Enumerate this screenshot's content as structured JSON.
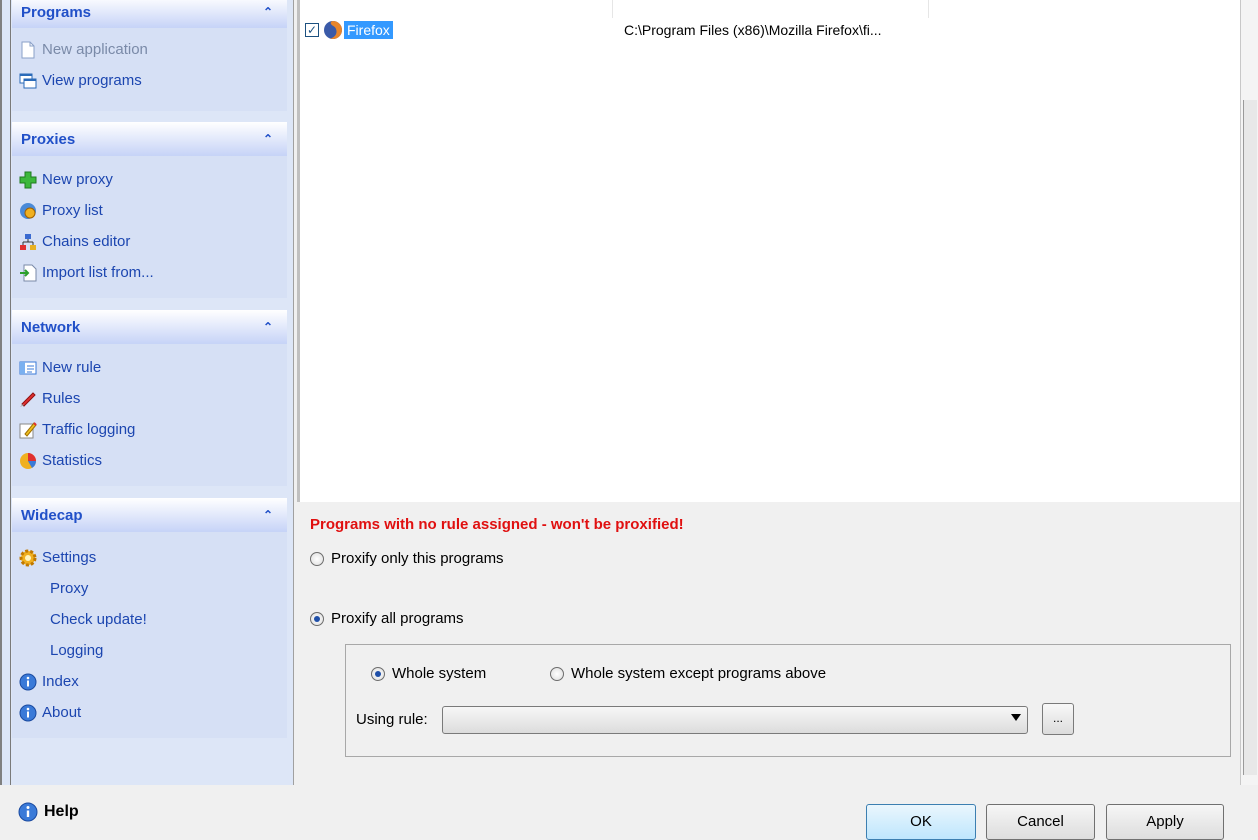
{
  "sidebar": {
    "sections": [
      {
        "title": "Programs",
        "items": [
          {
            "label": "New application",
            "icon": "document-icon",
            "disabled": true
          },
          {
            "label": "View programs",
            "icon": "windows-icon"
          }
        ]
      },
      {
        "title": "Proxies",
        "items": [
          {
            "label": "New proxy",
            "icon": "plus-icon"
          },
          {
            "label": "Proxy list",
            "icon": "globe-icon"
          },
          {
            "label": "Chains editor",
            "icon": "network-icon"
          },
          {
            "label": "Import list from...",
            "icon": "import-icon"
          }
        ]
      },
      {
        "title": "Network",
        "items": [
          {
            "label": "New rule",
            "icon": "rule-icon"
          },
          {
            "label": "Rules",
            "icon": "rocket-icon"
          },
          {
            "label": "Traffic logging",
            "icon": "pencil-icon"
          },
          {
            "label": "Statistics",
            "icon": "pie-chart-icon"
          }
        ]
      },
      {
        "title": "Widecap",
        "items": [
          {
            "label": "Settings",
            "icon": "gear-icon"
          },
          {
            "label": "Proxy",
            "icon": "",
            "indent": true
          },
          {
            "label": "Check update!",
            "icon": "",
            "indent": true
          },
          {
            "label": "Logging",
            "icon": "",
            "indent": true
          },
          {
            "label": "Index",
            "icon": "info-icon"
          },
          {
            "label": "About",
            "icon": "info-icon"
          }
        ]
      }
    ]
  },
  "program_list": {
    "rows": [
      {
        "checked": true,
        "name": "Firefox",
        "path": "C:\\Program Files (x86)\\Mozilla Firefox\\fi...",
        "icon": "firefox-icon"
      }
    ]
  },
  "settings": {
    "warning": "Programs with no rule assigned - won't be proxified!",
    "radio_only": "Proxify only this programs",
    "radio_all": "Proxify all programs",
    "selected_mode": "all",
    "sub_whole": "Whole system",
    "sub_except": "Whole system except programs above",
    "sub_selected": "whole",
    "using_rule_label": "Using rule:",
    "using_rule_value": "",
    "browse_label": "..."
  },
  "footer": {
    "help_label": "Help",
    "ok_label": "OK",
    "cancel_label": "Cancel",
    "apply_label": "Apply"
  },
  "colors": {
    "accent": "#2150c8",
    "warning": "#e01010",
    "selection": "#3399ff"
  }
}
